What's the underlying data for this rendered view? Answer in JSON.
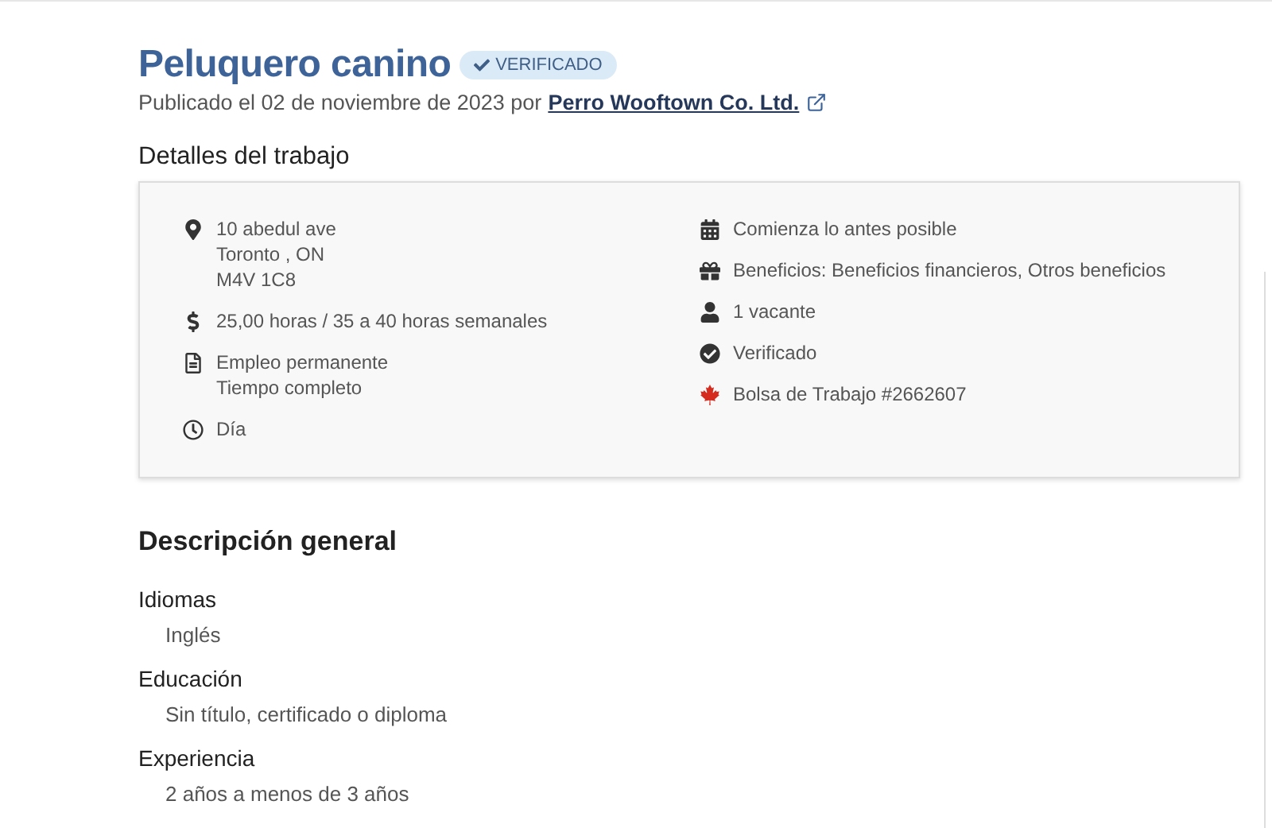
{
  "job": {
    "title": "Peluquero canino",
    "badge": {
      "label": "VERIFICADO"
    },
    "posted": "Publicado el 02 de noviembre de 2023 por",
    "employer": "Perro Wooftown Co. Ltd."
  },
  "details": {
    "heading": "Detalles del trabajo",
    "columns": [
      [
        {
          "kind": "location",
          "lines": [
            "10 abedul ave",
            "Toronto , ON",
            "M4V 1C8"
          ]
        },
        {
          "kind": "salary",
          "lines": [
            "25,00 horas / 35 a 40 horas semanales"
          ]
        },
        {
          "kind": "employment",
          "lines": [
            "Empleo permanente",
            "Tiempo completo"
          ]
        },
        {
          "kind": "schedule",
          "lines": [
            "Día"
          ]
        }
      ],
      [
        {
          "kind": "start",
          "lines": [
            "Comienza lo antes posible"
          ]
        },
        {
          "kind": "benefits",
          "lines": [
            "Beneficios: Beneficios financieros, Otros beneficios"
          ]
        },
        {
          "kind": "vacancies",
          "lines": [
            "1 vacante"
          ]
        },
        {
          "kind": "verified",
          "lines": [
            "Verificado"
          ]
        },
        {
          "kind": "source",
          "lines": [
            "Bolsa de Trabajo #2662607"
          ]
        }
      ]
    ]
  },
  "overview": {
    "heading": "Descripción general",
    "sections": [
      {
        "title": "Idiomas",
        "value": "Inglés"
      },
      {
        "title": "Educación",
        "value": "Sin título, certificado o diploma"
      },
      {
        "title": "Experiencia",
        "value": "2 años a menos de 3 años"
      }
    ]
  }
}
